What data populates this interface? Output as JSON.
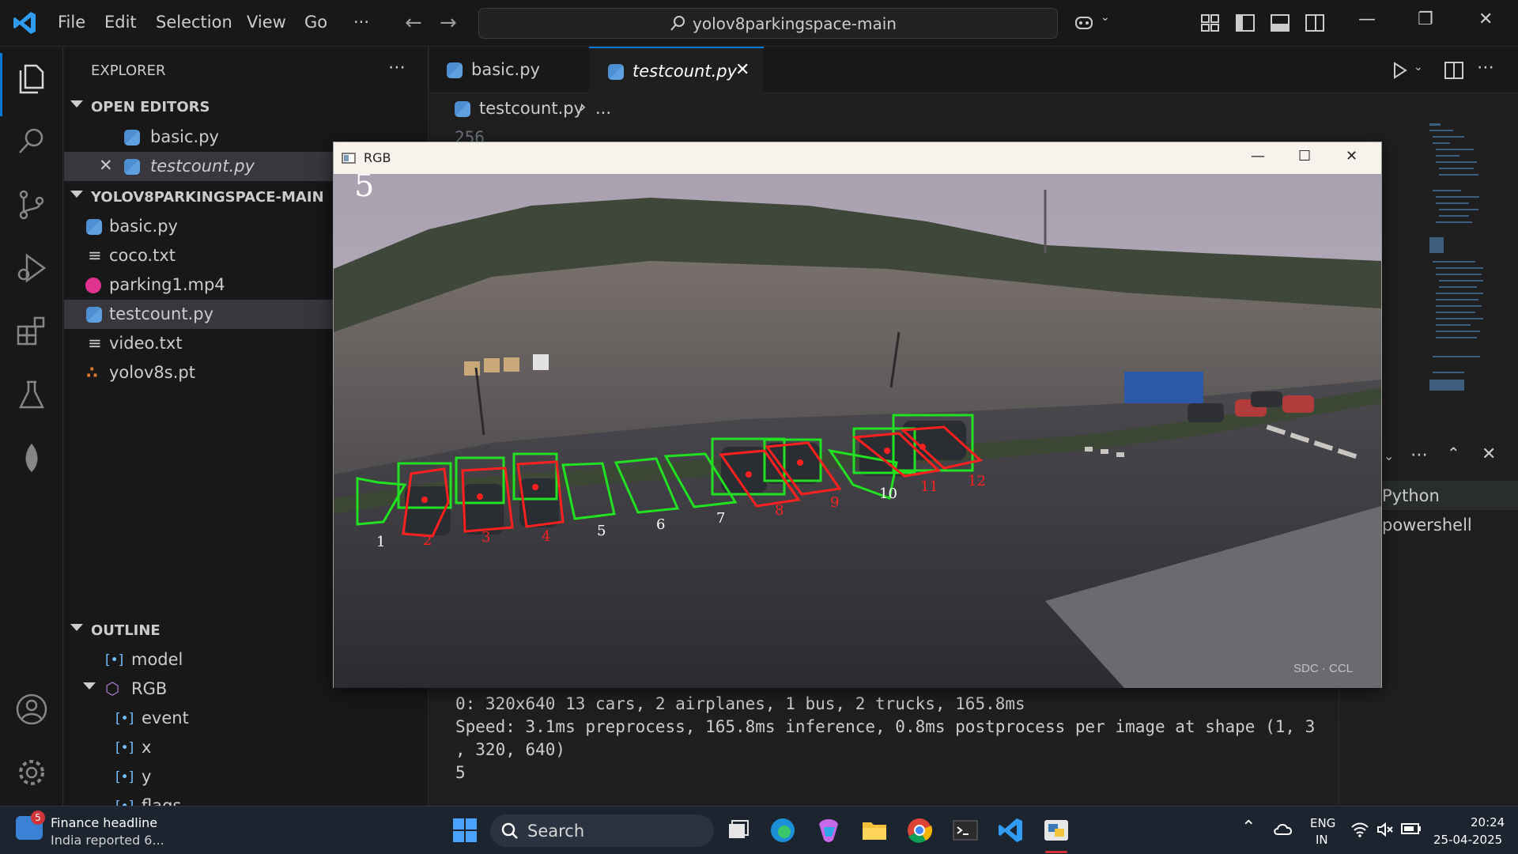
{
  "titlebar": {
    "menu": [
      "File",
      "Edit",
      "Selection",
      "View",
      "Go",
      "···"
    ],
    "search_text": "yolov8parkingspace-main"
  },
  "sidebar": {
    "explorer_title": "EXPLORER",
    "open_editors_title": "OPEN EDITORS",
    "open_editors": [
      "basic.py",
      "testcount.py"
    ],
    "folder_title": "YOLOV8PARKINGSPACE-MAIN",
    "files": [
      {
        "name": "basic.py",
        "icon": "python-file-icon"
      },
      {
        "name": "coco.txt",
        "icon": "text-file-icon"
      },
      {
        "name": "parking1.mp4",
        "icon": "video-file-icon"
      },
      {
        "name": "testcount.py",
        "icon": "python-file-icon"
      },
      {
        "name": "video.txt",
        "icon": "text-file-icon"
      },
      {
        "name": "yolov8s.pt",
        "icon": "rss-file-icon"
      }
    ],
    "outline_title": "OUTLINE",
    "outline": [
      {
        "name": "model",
        "kind": "variable"
      },
      {
        "name": "RGB",
        "kind": "function"
      },
      {
        "name": "event",
        "kind": "variable"
      },
      {
        "name": "x",
        "kind": "variable"
      },
      {
        "name": "y",
        "kind": "variable"
      },
      {
        "name": "flags",
        "kind": "variable"
      }
    ]
  },
  "editor": {
    "tabs": [
      "basic.py",
      "testcount.py"
    ],
    "active_tab": "testcount.py",
    "breadcrumb_file": "testcount.py",
    "breadcrumb_rest": "...",
    "line_number": "256"
  },
  "terminal": {
    "lines": [
      "0: 320x640 13 cars, 2 airplanes, 1 bus, 2 trucks, 165.8ms",
      "Speed: 3.1ms preprocess, 165.8ms inference, 0.8ms postprocess per image at shape (1, 3",
      ", 320, 640)",
      "5"
    ],
    "sessions": [
      "Python",
      "powershell"
    ]
  },
  "rgb_window": {
    "title": "RGB",
    "counter": "5",
    "watermark": "SDC · CCL",
    "slot_labels": [
      "1",
      "2",
      "3",
      "4",
      "5",
      "6",
      "7",
      "8",
      "9",
      "10",
      "11",
      "12"
    ]
  },
  "taskbar": {
    "news_badge": "5",
    "news_title": "Finance headline",
    "news_sub": "India reported 6...",
    "search_label": "Search",
    "lang_top": "ENG",
    "lang_bottom": "IN",
    "time": "20:24",
    "date": "25-04-2025"
  },
  "colors": {
    "accent": "#0078d4",
    "occupied": "#ff2020",
    "free": "#22e022"
  }
}
